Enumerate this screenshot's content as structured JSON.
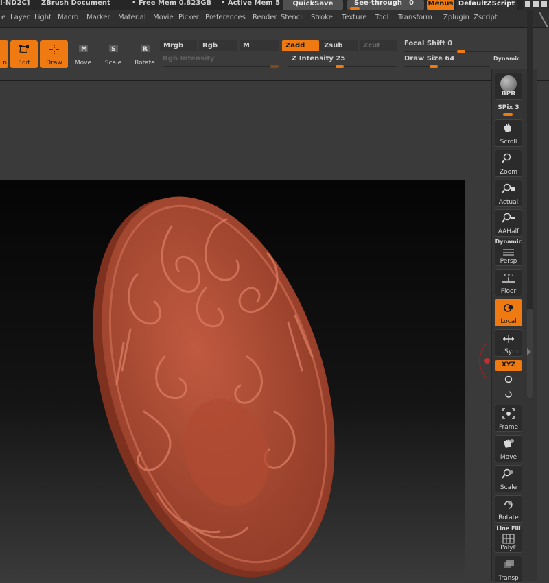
{
  "titlebar": {
    "doc_name": "I-ND2C]",
    "app_title": "ZBrush Document",
    "free_mem": "• Free Mem 0.823GB",
    "active_mem": "• Active Mem 5",
    "quicksave": "QuickSave",
    "see_through": "See-through",
    "see_through_value": "0",
    "menus": "Menus",
    "script": "DefaultZScript"
  },
  "menubar": {
    "items": [
      "e",
      "Layer",
      "Light",
      "Macro",
      "Marker",
      "Material",
      "Movie",
      "Picker",
      "Preferences",
      "Render",
      "Stencil",
      "Stroke",
      "Texture",
      "Tool",
      "Transform",
      "Zplugin",
      "Zscript"
    ]
  },
  "shelf": {
    "edge_label": "n",
    "edit": "Edit",
    "draw": "Draw",
    "move": "Move",
    "scale": "Scale",
    "rotate": "Rotate",
    "mrgb": "Mrgb",
    "rgb": "Rgb",
    "m": "M",
    "rgb_intensity": "Rgb Intensity",
    "zadd": "Zadd",
    "zsub": "Zsub",
    "zcut": "Zcut",
    "z_intensity": "Z Intensity 25",
    "focal_shift": "Focal Shift 0",
    "draw_size": "Draw Size 64",
    "dynamic": "Dynamic"
  },
  "rightbar": {
    "bpr": "BPR",
    "spix": "SPix 3",
    "scroll": "Scroll",
    "zoom": "Zoom",
    "actual": "Actual",
    "aahalf": "AAHalf",
    "dynamic": "Dynamic",
    "persp": "Persp",
    "floor": "Floor",
    "local": "Local",
    "lsym": "L.Sym",
    "xyz": "XYZ",
    "frame": "Frame",
    "move": "Move",
    "scale": "Scale",
    "rotate": "Rotate",
    "line_fill": "Line Fill",
    "polyf": "PolyF",
    "transp": "Transp"
  },
  "colors": {
    "accent": "#f07a12",
    "model": "#b04a32"
  }
}
